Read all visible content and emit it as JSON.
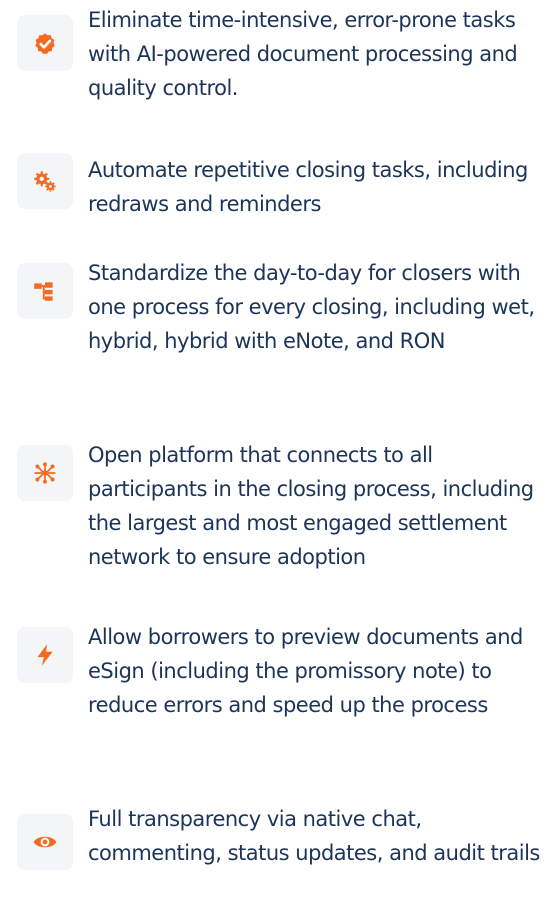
{
  "colors": {
    "accent": "#f36b21",
    "text": "#1c3458",
    "icon_tile": "#f4f5f7"
  },
  "features": [
    {
      "icon": "verified-badge-icon",
      "text": "Eliminate time-intensive, error-prone tasks with AI-powered document processing and quality control."
    },
    {
      "icon": "gears-icon",
      "text": "Automate repetitive closing tasks, including redraws and reminders"
    },
    {
      "icon": "hierarchy-icon",
      "text": "Standardize the day-to-day for closers with one process for every closing, including wet, hybrid, hybrid with eNote, and RON"
    },
    {
      "icon": "network-icon",
      "text": "Open platform that connects to all participants in the closing process, including the largest and most engaged settlement network to ensure adoption"
    },
    {
      "icon": "lightning-bolt-icon",
      "text": "Allow borrowers to preview documents and eSign (including the promissory note) to reduce errors and speed up the process"
    },
    {
      "icon": "eye-icon",
      "text": "Full transparency via native chat, commenting, status updates, and audit trails"
    }
  ]
}
